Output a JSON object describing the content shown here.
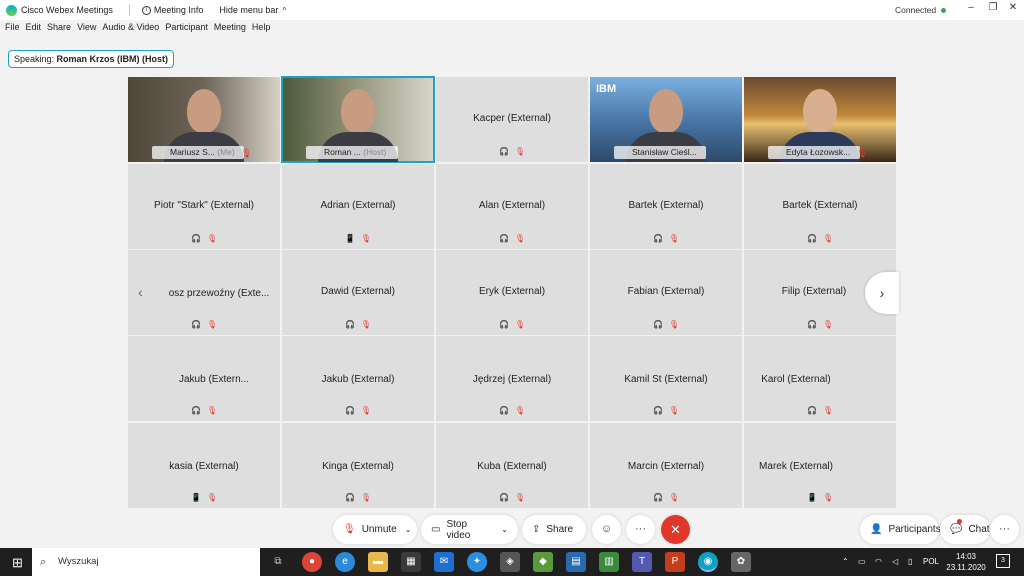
{
  "titlebar": {
    "app_title": "Cisco Webex Meetings",
    "meeting_info": "Meeting Info",
    "hide_menu": "Hide menu bar",
    "hide_chevron": "^",
    "status": "Connected",
    "min": "–",
    "restore": "❐",
    "close": "✕"
  },
  "menu": [
    "File",
    "Edit",
    "Share",
    "View",
    "Audio & Video",
    "Participant",
    "Meeting",
    "Help"
  ],
  "speaking": {
    "label": "Speaking:",
    "name": "Roman Krzos (IBM) (Host)"
  },
  "video_tiles": [
    {
      "name": "Mariusz S...",
      "role": "(Me)"
    },
    {
      "name": "Roman ...",
      "role": "(Host)"
    },
    {
      "name": "Kacper (External)"
    },
    {
      "name": "Stanisław Cieśl..."
    },
    {
      "name": "Edyta Łozowsk..."
    }
  ],
  "ibm_logo": "IBM",
  "rows": [
    [
      "Piotr \"Stark\" (External)",
      "Adrian (External)",
      "Alan  (External)",
      "Bartek  (External)",
      "Bartek  (External)"
    ],
    [
      "osz przewoźny (Exte...",
      "Dawid  (External)",
      "Eryk (External)",
      "Fabian (External)",
      "Filip  (External)"
    ],
    [
      "Jakub  (Extern...",
      "Jakub  (External)",
      "Jędrzej (External)",
      "Kamil St (External)",
      "Karol (External)"
    ],
    [
      "kasia (External)",
      "Kinga  (External)",
      "Kuba  (External)",
      "Marcin (External)",
      "Marek (External)"
    ]
  ],
  "controls": {
    "unmute": "Unmute",
    "stop_video": "Stop video",
    "share": "Share",
    "participants": "Participants",
    "chat": "Chat",
    "more": "···",
    "reactions": "☺",
    "end": "✕"
  },
  "taskbar": {
    "search": "Wyszukaj",
    "lang": "POL",
    "time": "14:03",
    "date": "23.11.2020",
    "notifications": "3"
  },
  "colors": {
    "accent": "#1aa3c7",
    "mute": "#e0372a",
    "connected": "#2fa84f"
  }
}
